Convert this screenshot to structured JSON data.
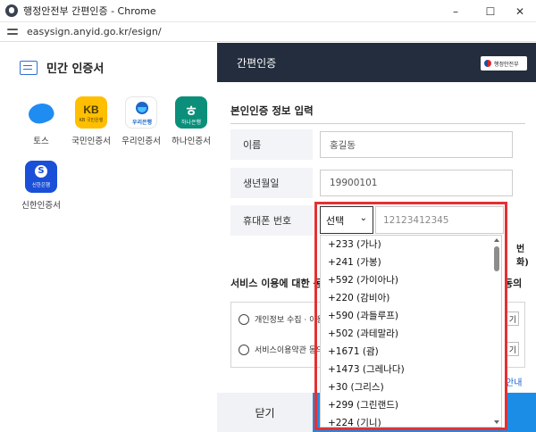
{
  "window": {
    "title": "행정안전부 간편인증 - Chrome",
    "minimize": "–",
    "maximize": "☐",
    "close": "✕"
  },
  "address": {
    "url": "easysign.anyid.go.kr/esign/"
  },
  "left_panel": {
    "heading": "민간 인증서",
    "providers": [
      {
        "name": "토스",
        "logo": "toss-logo"
      },
      {
        "name": "국민인증서",
        "logo": "kb-logo",
        "logo_text": "KB",
        "logo_sub": "KB 국민은행"
      },
      {
        "name": "우리인증서",
        "logo": "woori-logo",
        "logo_sub": "우리은행"
      },
      {
        "name": "하나인증서",
        "logo": "hana-logo",
        "logo_glyph": "ㅎ",
        "logo_sub": "하나은행"
      },
      {
        "name": "신한인증서",
        "logo": "shinhan-logo",
        "logo_sub": "신한은행"
      }
    ]
  },
  "right_panel": {
    "header_title": "간편인증",
    "gov_badge": "행정안전부",
    "form_title": "본인인증 정보 입력",
    "name_label": "이름",
    "name_placeholder": "홍길동",
    "birth_label": "생년월일",
    "birth_placeholder": "19900101",
    "phone_label": "휴대폰 번호",
    "phone_select_value": "선택",
    "phone_placeholder": "12123412345",
    "tel_note_tail": "번화)",
    "consent_title": "서비스 이용에 대한 동",
    "consent_tail": "동의",
    "consent_items": [
      {
        "label": "개인정보 수집 · 이용",
        "button": "기"
      },
      {
        "label": "서비스이용약관 동의",
        "button": "기"
      }
    ],
    "guide_note": "안내",
    "close_button": "닫기"
  },
  "country_options": [
    "+233 (가나)",
    "+241 (가봉)",
    "+592 (가이아나)",
    "+220 (감비아)",
    "+590 (과들루프)",
    "+502 (과테말라)",
    "+1671 (괌)",
    "+1473 (그레나다)",
    "+30 (그리스)",
    "+299 (그린랜드)",
    "+224 (기니)"
  ],
  "colors": {
    "header_bg": "#232d3d",
    "primary_button": "#1b8de6",
    "highlight": "#e53033"
  }
}
